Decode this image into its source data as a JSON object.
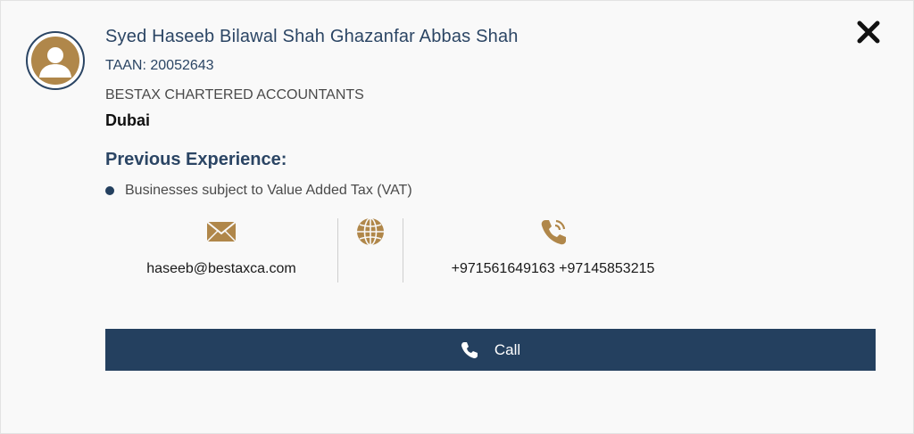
{
  "profile": {
    "name": "Syed Haseeb Bilawal Shah Ghazanfar Abbas Shah",
    "taan": "TAAN: 20052643",
    "company": "BESTAX CHARTERED ACCOUNTANTS",
    "city": "Dubai"
  },
  "experience": {
    "title": "Previous Experience:",
    "items": [
      "Businesses subject to Value Added Tax (VAT)"
    ]
  },
  "contact": {
    "email": "haseeb@bestaxca.com",
    "phones": "+971561649163 +97145853215"
  },
  "actions": {
    "call_label": "Call"
  },
  "icons": {
    "close": "close-icon",
    "avatar": "user-avatar-icon",
    "email": "envelope-icon",
    "website": "globe-icon",
    "phone": "phone-ringing-icon",
    "call": "phone-icon"
  },
  "colors": {
    "primary": "#24405f",
    "accent": "#b0874a",
    "background": "#f9f9f9"
  }
}
